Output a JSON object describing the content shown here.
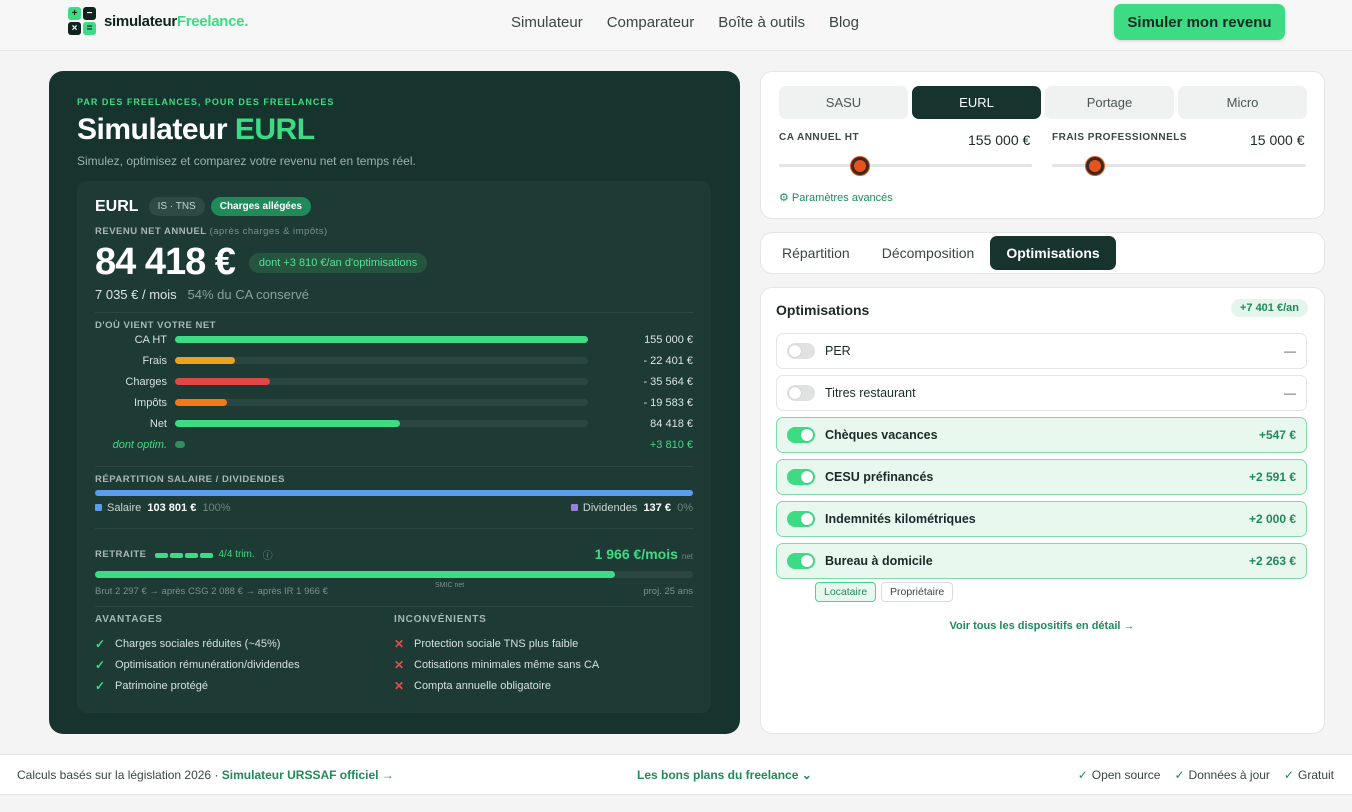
{
  "brand": {
    "part1": "simulateur",
    "part2": "Freelance",
    "dot": "."
  },
  "nav": [
    "Simulateur",
    "Comparateur",
    "Boîte à outils",
    "Blog"
  ],
  "cta": "Simuler mon revenu",
  "hero": {
    "kicker": "PAR DES FREELANCES, POUR DES FREELANCES",
    "title": "Simulateur ",
    "title_accent": "EURL",
    "subtitle": "Simulez, optimisez et comparez votre revenu net en temps réel."
  },
  "result": {
    "status": "EURL",
    "chip_tax": "IS · TNS",
    "chip_charges": "Charges allégées",
    "net_label": "REVENU NET ANNUEL",
    "net_label_note": "(après charges & impôts)",
    "net_value": "84 418 €",
    "optim_chip": "dont +3 810 €/an d'optimisations",
    "monthly": "7 035 €",
    "monthly_unit": " / mois",
    "kept": "54% du CA conservé",
    "breakdown_label": "D'OÙ VIENT VOTRE NET",
    "breakdown": [
      {
        "label": "CA HT",
        "display": "155 000 €",
        "fraction": 1.0,
        "color": "#3ddc84"
      },
      {
        "label": "Frais",
        "display": "- 22 401 €",
        "fraction": 0.145,
        "color": "#f0a020"
      },
      {
        "label": "Charges",
        "display": "- 35 564 €",
        "fraction": 0.229,
        "color": "#e04848"
      },
      {
        "label": "Impôts",
        "display": "- 19 583 €",
        "fraction": 0.126,
        "color": "#f07a1a"
      },
      {
        "label": "Net",
        "display": "84 418 €",
        "fraction": 0.545,
        "color": "#3ddc84"
      },
      {
        "label": "dont optim.",
        "display": "+3 810 €",
        "fraction": 0.025,
        "color": "#2f8f5e",
        "italic": true
      }
    ],
    "split_label": "RÉPARTITION SALAIRE / DIVIDENDES",
    "salary_label": "Salaire",
    "salary_value": "103 801 €",
    "salary_pct": "100%",
    "dividends_label": "Dividendes",
    "dividends_value": "137 €",
    "dividends_pct": "0%",
    "retirement_label": "RETRAITE",
    "retirement_trim": "4/4 trim.",
    "retirement_value": "1 966 €/mois",
    "retirement_unit": "net",
    "retirement_fraction": 0.87,
    "smic_label": "SMIC net",
    "retirement_detail": "Brut 2 297 € → après CSG 2 088 € → après IR 1 966 €",
    "retirement_proj": "proj. 25 ans",
    "pros_title": "AVANTAGES",
    "pros": [
      "Charges sociales réduites (~45%)",
      "Optimisation rémunération/dividendes",
      "Patrimoine protégé"
    ],
    "cons_title": "INCONVÉNIENTS",
    "cons": [
      "Protection sociale TNS plus faible",
      "Cotisations minimales même sans CA",
      "Compta annuelle obligatoire"
    ]
  },
  "config": {
    "statuses": [
      "SASU",
      "EURL",
      "Portage",
      "Micro"
    ],
    "active_status": "EURL",
    "ca_label": "CA ANNUEL HT",
    "ca_value": "155 000 €",
    "ca_slider_fraction": 0.32,
    "frais_label": "FRAIS PROFESSIONNELS",
    "frais_value": "15 000 €",
    "frais_slider_fraction": 0.17,
    "advanced": "⚙ Paramètres avancés"
  },
  "tabs": [
    "Répartition",
    "Décomposition",
    "Optimisations"
  ],
  "active_tab": "Optimisations",
  "optimisations": {
    "title": "Optimisations",
    "total": "+7 401 €/an",
    "items": [
      {
        "name": "PER",
        "value": "—",
        "on": false
      },
      {
        "name": "Titres restaurant",
        "value": "—",
        "on": false
      },
      {
        "name": "Chèques vacances",
        "value": "+547 €",
        "on": true
      },
      {
        "name": "CESU préfinancés",
        "value": "+2 591 €",
        "on": true
      },
      {
        "name": "Indemnités kilométriques",
        "value": "+2 000 €",
        "on": true
      },
      {
        "name": "Bureau à domicile",
        "value": "+2 263 €",
        "on": true
      }
    ],
    "housing_options": [
      "Locataire",
      "Propriétaire"
    ],
    "housing_selected": "Locataire",
    "see_all": "Voir tous les dispositifs en détail →"
  },
  "footer": {
    "left_text": "Calculs basés sur la législation 2026 · ",
    "left_link": "Simulateur URSSAF officiel →",
    "center": "Les bons plans du freelance ⌄",
    "badges": [
      "Open source",
      "Données à jour",
      "Gratuit"
    ]
  },
  "colors": {
    "accent": "#3ddc84",
    "dark": "#17332d",
    "salary": "#5b9cf0",
    "dividends": "#9b7fe0"
  }
}
